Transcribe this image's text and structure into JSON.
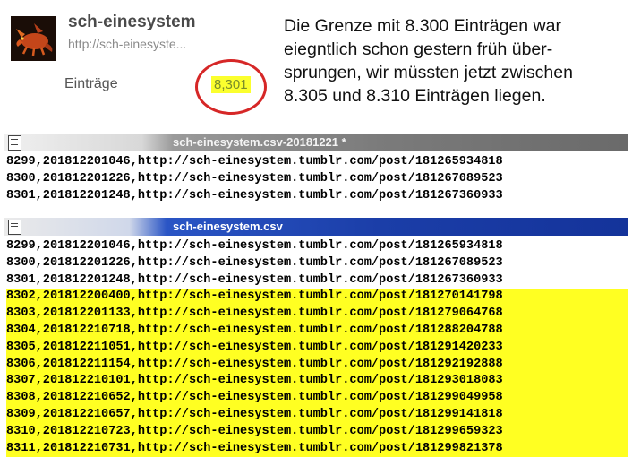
{
  "blog": {
    "name": "sch-einesystem",
    "url": "http://sch-einesyste...",
    "entries_label": "Einträge",
    "entries_count": "8,301"
  },
  "note": "Die Grenze mit 8.300 Einträgen war\neiegntlich schon gestern früh über-\nsprungen, wir müssten jetzt zwischen\n8.305 und 8.310 Einträgen liegen.",
  "old_file": {
    "title": "sch-einesystem.csv-20181221 *",
    "lines": [
      "8299,201812201046,http://sch-einesystem.tumblr.com/post/181265934818",
      "8300,201812201226,http://sch-einesystem.tumblr.com/post/181267089523",
      "8301,201812201248,http://sch-einesystem.tumblr.com/post/181267360933"
    ]
  },
  "new_file": {
    "title": "sch-einesystem.csv",
    "lines": [
      "8299,201812201046,http://sch-einesystem.tumblr.com/post/181265934818",
      "8300,201812201226,http://sch-einesystem.tumblr.com/post/181267089523",
      "8301,201812201248,http://sch-einesystem.tumblr.com/post/181267360933",
      "8302,201812200400,http://sch-einesystem.tumblr.com/post/181270141798",
      "8303,201812201133,http://sch-einesystem.tumblr.com/post/181279064768",
      "8304,201812210718,http://sch-einesystem.tumblr.com/post/181288204788",
      "8305,201812211051,http://sch-einesystem.tumblr.com/post/181291420233",
      "8306,201812211154,http://sch-einesystem.tumblr.com/post/181292192888",
      "8307,201812210101,http://sch-einesystem.tumblr.com/post/181293018083",
      "8308,201812210652,http://sch-einesystem.tumblr.com/post/181299049958",
      "8309,201812210657,http://sch-einesystem.tumblr.com/post/181299141818",
      "8310,201812210723,http://sch-einesystem.tumblr.com/post/181299659323",
      "8311,201812210731,http://sch-einesystem.tumblr.com/post/181299821378"
    ],
    "highlighted_from_index": 3
  },
  "colors": {
    "highlight": "#ffff22",
    "circle": "#d62727",
    "count_bg": "#fbff2e",
    "active_title": "#1b3ea8"
  },
  "icons": {
    "avatar": "dragon-avatar-icon",
    "file": "notepad-file-icon"
  }
}
